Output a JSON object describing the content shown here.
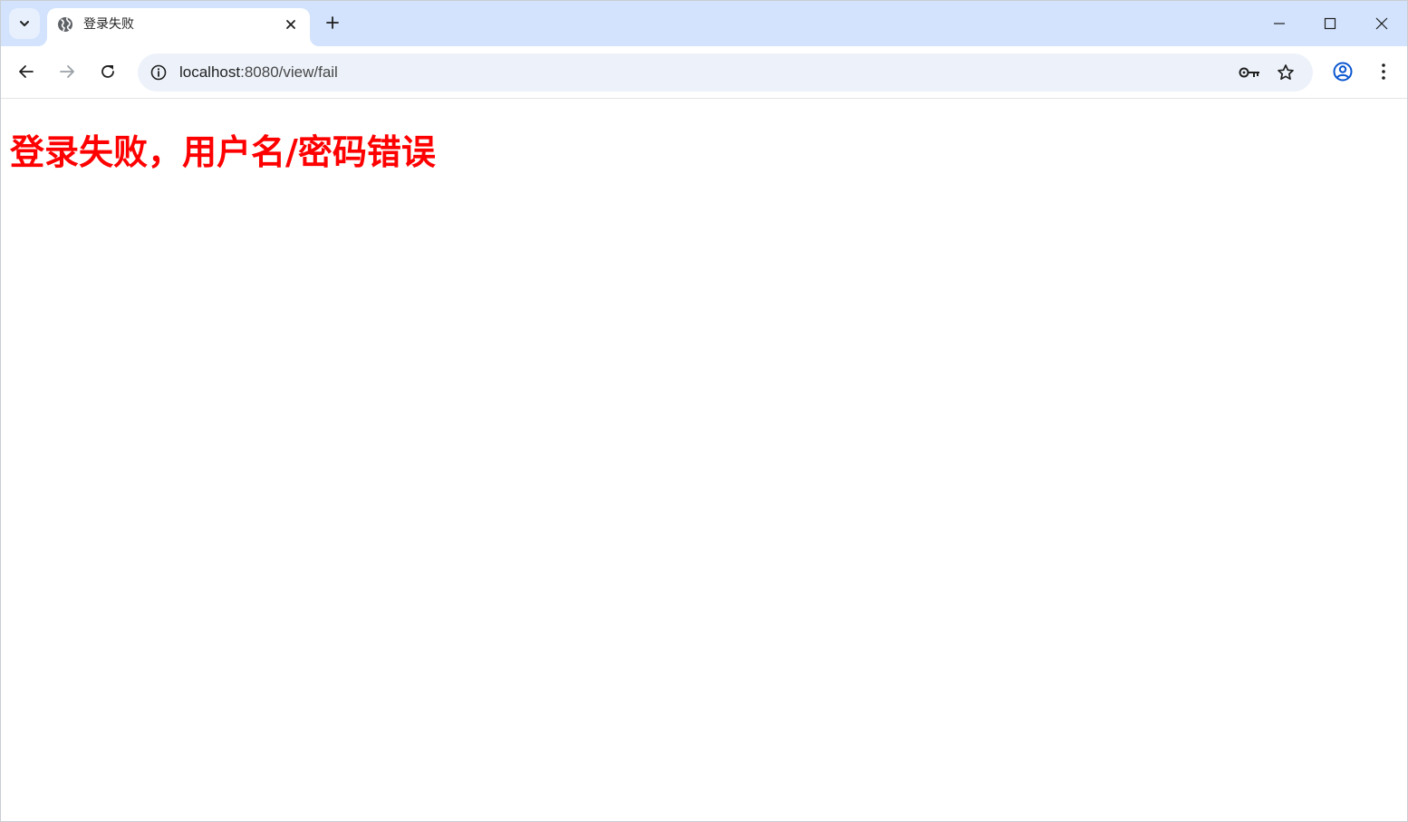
{
  "browser": {
    "tab": {
      "title": "登录失败"
    },
    "address_bar": {
      "url_host": "localhost",
      "url_rest": ":8080/view/fail"
    }
  },
  "page": {
    "heading": "登录失败，用户名/密码错误",
    "heading_color": "#ff0000"
  },
  "icons": {
    "tab_search": "chevron-down-icon",
    "favicon": "globe-icon",
    "tab_close": "close-icon",
    "new_tab": "plus-icon",
    "minimize": "minimize-icon",
    "maximize": "maximize-icon",
    "close_window": "close-icon",
    "back": "arrow-left-icon",
    "forward": "arrow-right-icon",
    "reload": "reload-icon",
    "site_info": "info-icon",
    "password_key": "key-icon",
    "bookmark": "star-icon",
    "profile": "profile-icon",
    "menu": "kebab-menu-icon"
  }
}
